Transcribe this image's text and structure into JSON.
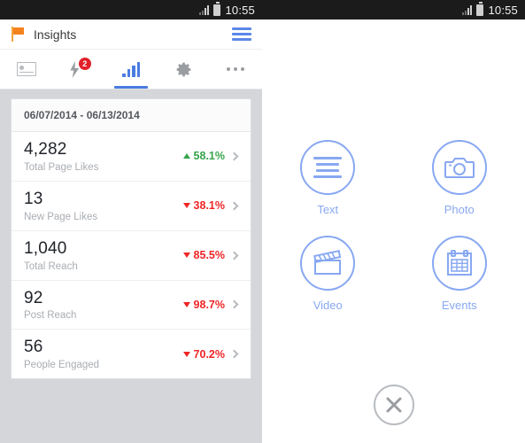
{
  "left_screen": {
    "statusbar": {
      "time": "10:55",
      "signal_icon": "signal-bars-icon",
      "battery_icon": "battery-icon"
    },
    "appbar": {
      "flag_icon": "flag-icon",
      "title": "Insights",
      "menu_icon": "hamburger-menu-icon"
    },
    "tabs": [
      {
        "name": "tab-pages",
        "icon": "page-card-icon",
        "active": false,
        "badge": null
      },
      {
        "name": "tab-notifications",
        "icon": "lightning-bolt-icon",
        "active": false,
        "badge": "2"
      },
      {
        "name": "tab-insights",
        "icon": "bar-chart-icon",
        "active": true,
        "badge": null
      },
      {
        "name": "tab-settings",
        "icon": "gear-icon",
        "active": false,
        "badge": null
      },
      {
        "name": "tab-more",
        "icon": "overflow-dots-icon",
        "active": false,
        "badge": null
      }
    ],
    "card": {
      "date_range": "06/07/2014 - 06/13/2014",
      "rows": [
        {
          "value": "4,282",
          "label": "Total Page Likes",
          "delta": "58.1%",
          "direction": "up"
        },
        {
          "value": "13",
          "label": "New Page Likes",
          "delta": "38.1%",
          "direction": "down"
        },
        {
          "value": "1,040",
          "label": "Total Reach",
          "delta": "85.5%",
          "direction": "down"
        },
        {
          "value": "92",
          "label": "Post Reach",
          "delta": "98.7%",
          "direction": "down"
        },
        {
          "value": "56",
          "label": "People Engaged",
          "delta": "70.2%",
          "direction": "down"
        }
      ]
    }
  },
  "right_screen": {
    "statusbar": {
      "time": "10:55",
      "signal_icon": "signal-bars-icon",
      "battery_icon": "battery-icon"
    },
    "actions": [
      {
        "label": "Text",
        "icon": "text-lines-icon"
      },
      {
        "label": "Photo",
        "icon": "camera-icon"
      },
      {
        "label": "Video",
        "icon": "clapperboard-icon"
      },
      {
        "label": "Events",
        "icon": "calendar-icon"
      }
    ],
    "close_icon": "close-x-icon"
  },
  "colors": {
    "accent_blue": "#4a7ce0",
    "icon_blue": "#88a8f2",
    "flag_orange": "#f5821f",
    "up_green": "#36a44a",
    "down_red": "#ef2525",
    "badge_red": "#e0202a",
    "page_bg": "#d4d6da"
  }
}
